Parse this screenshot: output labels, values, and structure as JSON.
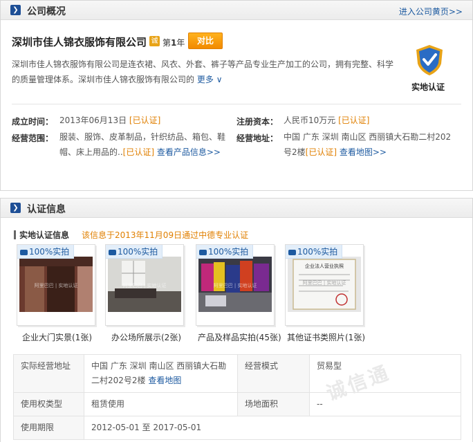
{
  "overview": {
    "title": "公司概况",
    "homepage_link": "进入公司黄页>>",
    "company_name": "深圳市佳人锦衣服饰有限公司",
    "cheng_icon": "诚",
    "year_prefix": "第",
    "year_num": "1",
    "year_suffix": "年",
    "compare_label": "对比",
    "description": "深圳市佳人锦衣服饰有限公司是连衣裙、风衣、外套、裤子等产品专业生产加工的公司，拥有完整、科学的质量管理体系。深圳市佳人锦衣服饰有限公司的",
    "more_label": "更多",
    "shield_label": "实地认证",
    "fields": {
      "founded_label": "成立时间：",
      "founded_value": "2013年06月13日",
      "founded_badge": "[已认证]",
      "capital_label": "注册资本：",
      "capital_value": "人民币10万元",
      "capital_badge": "[已认证]",
      "scope_label": "经营范围：",
      "scope_value": "服装、服饰、皮革制品，针织纺品、箱包、鞋帽、床上用品的..",
      "scope_badge": "[已认证]",
      "scope_link": "查看产品信息>>",
      "address_label": "经营地址：",
      "address_value": "中国 广东 深圳 南山区 西丽镇大石勘二村202号2楼",
      "address_badge": "[已认证]",
      "address_link": "查看地图>>"
    }
  },
  "cert": {
    "title": "认证信息",
    "section_title": "实地认证信息",
    "section_note": "该信息于2013年11月09日通过中德专业认证",
    "photo_tag": "100%实拍",
    "watermark_text": "阿里巴巴 | 实地认证",
    "cert_doc_title": "企业法人营业执照",
    "photos": [
      {
        "caption": "企业大门实景(1张)"
      },
      {
        "caption": "办公场所展示(2张)"
      },
      {
        "caption": "产品及样品实拍(45张)"
      },
      {
        "caption": "其他证书类照片(1张)"
      }
    ],
    "table": {
      "addr_label": "实际经营地址",
      "addr_value": "中国 广东 深圳 南山区 西丽镇大石勘二村202号2楼",
      "map_link": "查看地图",
      "mode_label": "经营模式",
      "mode_value": "贸易型",
      "right_label": "使用权类型",
      "right_value": "租赁使用",
      "area_label": "场地面积",
      "area_value": "--",
      "period_label": "使用期限",
      "period_value": "2012-05-01 至 2017-05-01"
    },
    "page_watermark": "诚信通"
  },
  "colors": {
    "accent": "#1d5aa0",
    "badge": "#e07f00",
    "button": "#f28a00",
    "icon_bg": "#1e4f96"
  }
}
